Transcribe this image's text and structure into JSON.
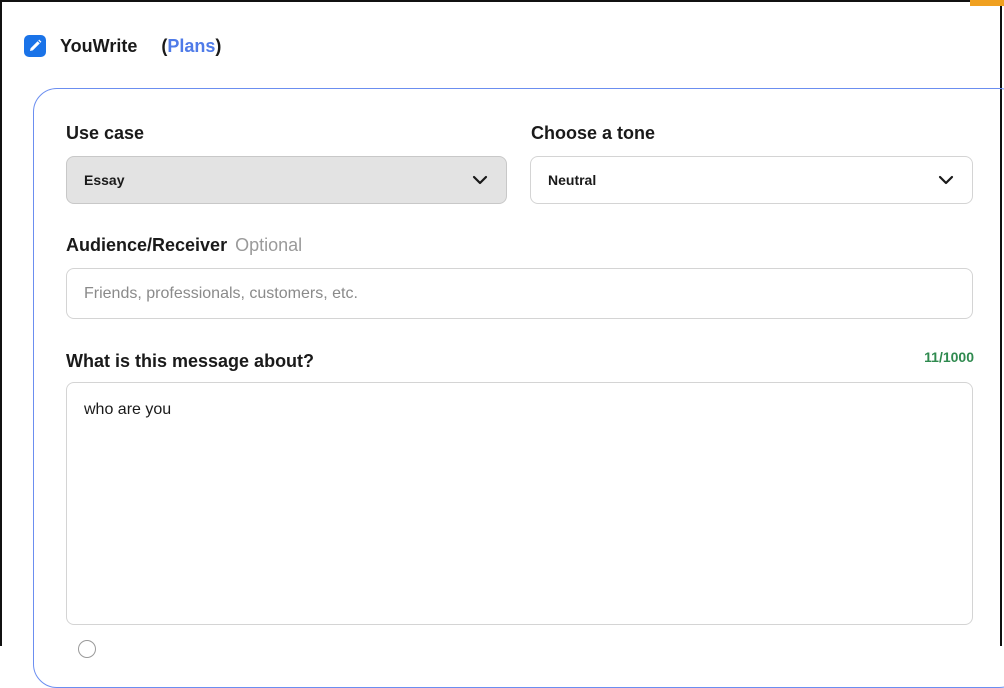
{
  "header": {
    "app_title": "YouWrite",
    "plans_open": "(",
    "plans_label": "Plans",
    "plans_close": ")",
    "icon": "pencil-edit-icon"
  },
  "form": {
    "use_case": {
      "label": "Use case",
      "value": "Essay",
      "icon": "chevron-down-icon"
    },
    "tone": {
      "label": "Choose a tone",
      "value": "Neutral",
      "icon": "chevron-down-icon"
    },
    "audience": {
      "label": "Audience/Receiver",
      "optional_label": "Optional",
      "placeholder": "Friends, professionals, customers, etc.",
      "value": ""
    },
    "message": {
      "label": "What is this message about?",
      "counter": "11/1000",
      "value": "who are you"
    }
  },
  "colors": {
    "accent": "#4f7be8",
    "card_border": "#6b8ef0",
    "counter": "#2f8a4f",
    "icon_bg": "#1a73e8"
  }
}
